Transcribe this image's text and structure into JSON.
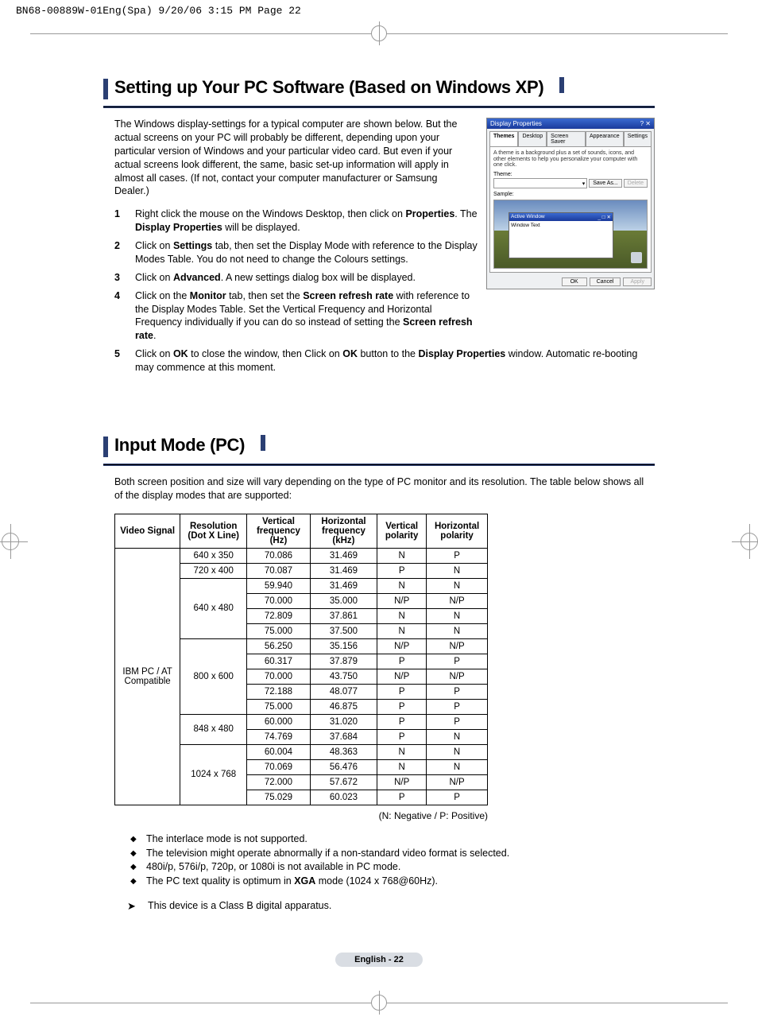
{
  "print_header": "BN68-00889W-01Eng(Spa)  9/20/06  3:15 PM  Page 22",
  "section1": {
    "title": "Setting up Your PC Software (Based on Windows XP)",
    "intro": "The Windows display-settings for a typical computer are shown below. But the actual screens on your PC will probably be different, depending upon your particular version of Windows and your particular video card. But even if your actual screens look different, the same, basic set-up information will apply in almost all cases. (If not, contact your computer manufacturer or Samsung Dealer.)",
    "steps": {
      "s1a": "Right click the mouse on the Windows Desktop, then click on ",
      "s1b": "Properties",
      "s1c": ". The ",
      "s1d": "Display Properties",
      "s1e": " will be displayed.",
      "s2a": "Click on ",
      "s2b": "Settings",
      "s2c": " tab, then set the Display Mode with reference to the Display Modes Table. You do not need to change the Colours settings.",
      "s3a": "Click on ",
      "s3b": "Advanced",
      "s3c": ". A new settings dialog box will be displayed.",
      "s4a": "Click on the ",
      "s4b": "Monitor",
      "s4c": " tab, then set the ",
      "s4d": "Screen refresh rate",
      "s4e": " with reference to the Display Modes Table. Set the Vertical Frequency and Horizontal Frequency individually if you can do so instead of setting the ",
      "s4f": "Screen refresh rate",
      "s4g": ".",
      "s5a": "Click on ",
      "s5b": "OK",
      "s5c": " to close the window, then Click on ",
      "s5d": "OK",
      "s5e": " button to the ",
      "s5f": "Display Properties",
      "s5g": " window. Automatic re-booting may commence at this moment."
    }
  },
  "dialog": {
    "title": "Display Properties",
    "tabs": {
      "t1": "Themes",
      "t2": "Desktop",
      "t3": "Screen Saver",
      "t4": "Appearance",
      "t5": "Settings"
    },
    "hint": "A theme is a background plus a set of sounds, icons, and other elements to help you personalize your computer with one click.",
    "theme_label": "Theme:",
    "browse": "Save As...",
    "delete": "Delete",
    "sample": "Sample:",
    "active": "Active Window",
    "wintext": "Window Text",
    "ok": "OK",
    "cancel": "Cancel",
    "apply": "Apply"
  },
  "section2": {
    "title": "Input Mode (PC)",
    "intro": "Both screen position and size will vary depending on the type of PC monitor and its resolution. The table below shows all of the display modes that are supported:"
  },
  "table": {
    "headers": {
      "h1": "Video Signal",
      "h2": "Resolution (Dot X Line)",
      "h3": "Vertical frequency (Hz)",
      "h4": "Horizontal frequency (kHz)",
      "h5": "Vertical polarity",
      "h6": "Horizontal polarity"
    },
    "signal": "IBM PC / AT Compatible",
    "res": {
      "r1": "640 x 350",
      "r2": "720 x 400",
      "r3": "640 x 480",
      "r4": "800 x 600",
      "r5": "848 x 480",
      "r6": "1024 x 768"
    },
    "rows": [
      {
        "vf": "70.086",
        "hf": "31.469",
        "vp": "N",
        "hp": "P"
      },
      {
        "vf": "70.087",
        "hf": "31.469",
        "vp": "P",
        "hp": "N"
      },
      {
        "vf": "59.940",
        "hf": "31.469",
        "vp": "N",
        "hp": "N"
      },
      {
        "vf": "70.000",
        "hf": "35.000",
        "vp": "N/P",
        "hp": "N/P"
      },
      {
        "vf": "72.809",
        "hf": "37.861",
        "vp": "N",
        "hp": "N"
      },
      {
        "vf": "75.000",
        "hf": "37.500",
        "vp": "N",
        "hp": "N"
      },
      {
        "vf": "56.250",
        "hf": "35.156",
        "vp": "N/P",
        "hp": "N/P"
      },
      {
        "vf": "60.317",
        "hf": "37.879",
        "vp": "P",
        "hp": "P"
      },
      {
        "vf": "70.000",
        "hf": "43.750",
        "vp": "N/P",
        "hp": "N/P"
      },
      {
        "vf": "72.188",
        "hf": "48.077",
        "vp": "P",
        "hp": "P"
      },
      {
        "vf": "75.000",
        "hf": "46.875",
        "vp": "P",
        "hp": "P"
      },
      {
        "vf": "60.000",
        "hf": "31.020",
        "vp": "P",
        "hp": "P"
      },
      {
        "vf": "74.769",
        "hf": "37.684",
        "vp": "P",
        "hp": "N"
      },
      {
        "vf": "60.004",
        "hf": "48.363",
        "vp": "N",
        "hp": "N"
      },
      {
        "vf": "70.069",
        "hf": "56.476",
        "vp": "N",
        "hp": "N"
      },
      {
        "vf": "72.000",
        "hf": "57.672",
        "vp": "N/P",
        "hp": "N/P"
      },
      {
        "vf": "75.029",
        "hf": "60.023",
        "vp": "P",
        "hp": "P"
      }
    ],
    "legend": "(N: Negative / P: Positive)"
  },
  "bullets": {
    "b1": "The interlace mode is not supported.",
    "b2": "The television might operate abnormally if a non-standard video format is selected.",
    "b3": "480i/p, 576i/p, 720p, or 1080i is not available in PC mode.",
    "b4a": "The PC text quality is optimum in ",
    "b4b": "XGA",
    "b4c": " mode (1024 x 768@60Hz)."
  },
  "arrow_note": "This device is a Class B digital apparatus.",
  "footer": "English - 22"
}
